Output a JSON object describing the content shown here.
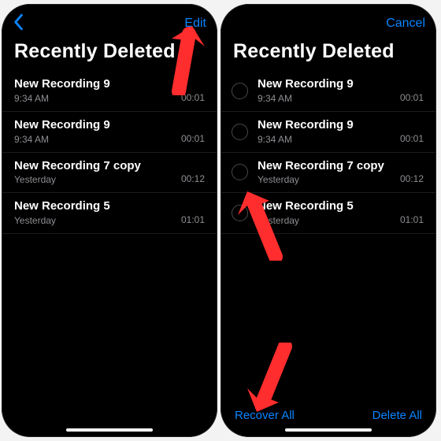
{
  "accentColor": "#0a84ff",
  "left": {
    "title": "Recently Deleted",
    "editLabel": "Edit",
    "rows": [
      {
        "title": "New Recording 9",
        "sub": "9:34 AM",
        "dur": "00:01"
      },
      {
        "title": "New Recording 9",
        "sub": "9:34 AM",
        "dur": "00:01"
      },
      {
        "title": "New Recording 7 copy",
        "sub": "Yesterday",
        "dur": "00:12"
      },
      {
        "title": "New Recording 5",
        "sub": "Yesterday",
        "dur": "01:01"
      }
    ]
  },
  "right": {
    "title": "Recently Deleted",
    "cancelLabel": "Cancel",
    "recoverAllLabel": "Recover All",
    "deleteAllLabel": "Delete All",
    "rows": [
      {
        "title": "New Recording 9",
        "sub": "9:34 AM",
        "dur": "00:01"
      },
      {
        "title": "New Recording 9",
        "sub": "9:34 AM",
        "dur": "00:01"
      },
      {
        "title": "New Recording 7 copy",
        "sub": "Yesterday",
        "dur": "00:12"
      },
      {
        "title": "New Recording 5",
        "sub": "Yesterday",
        "dur": "01:01"
      }
    ]
  }
}
